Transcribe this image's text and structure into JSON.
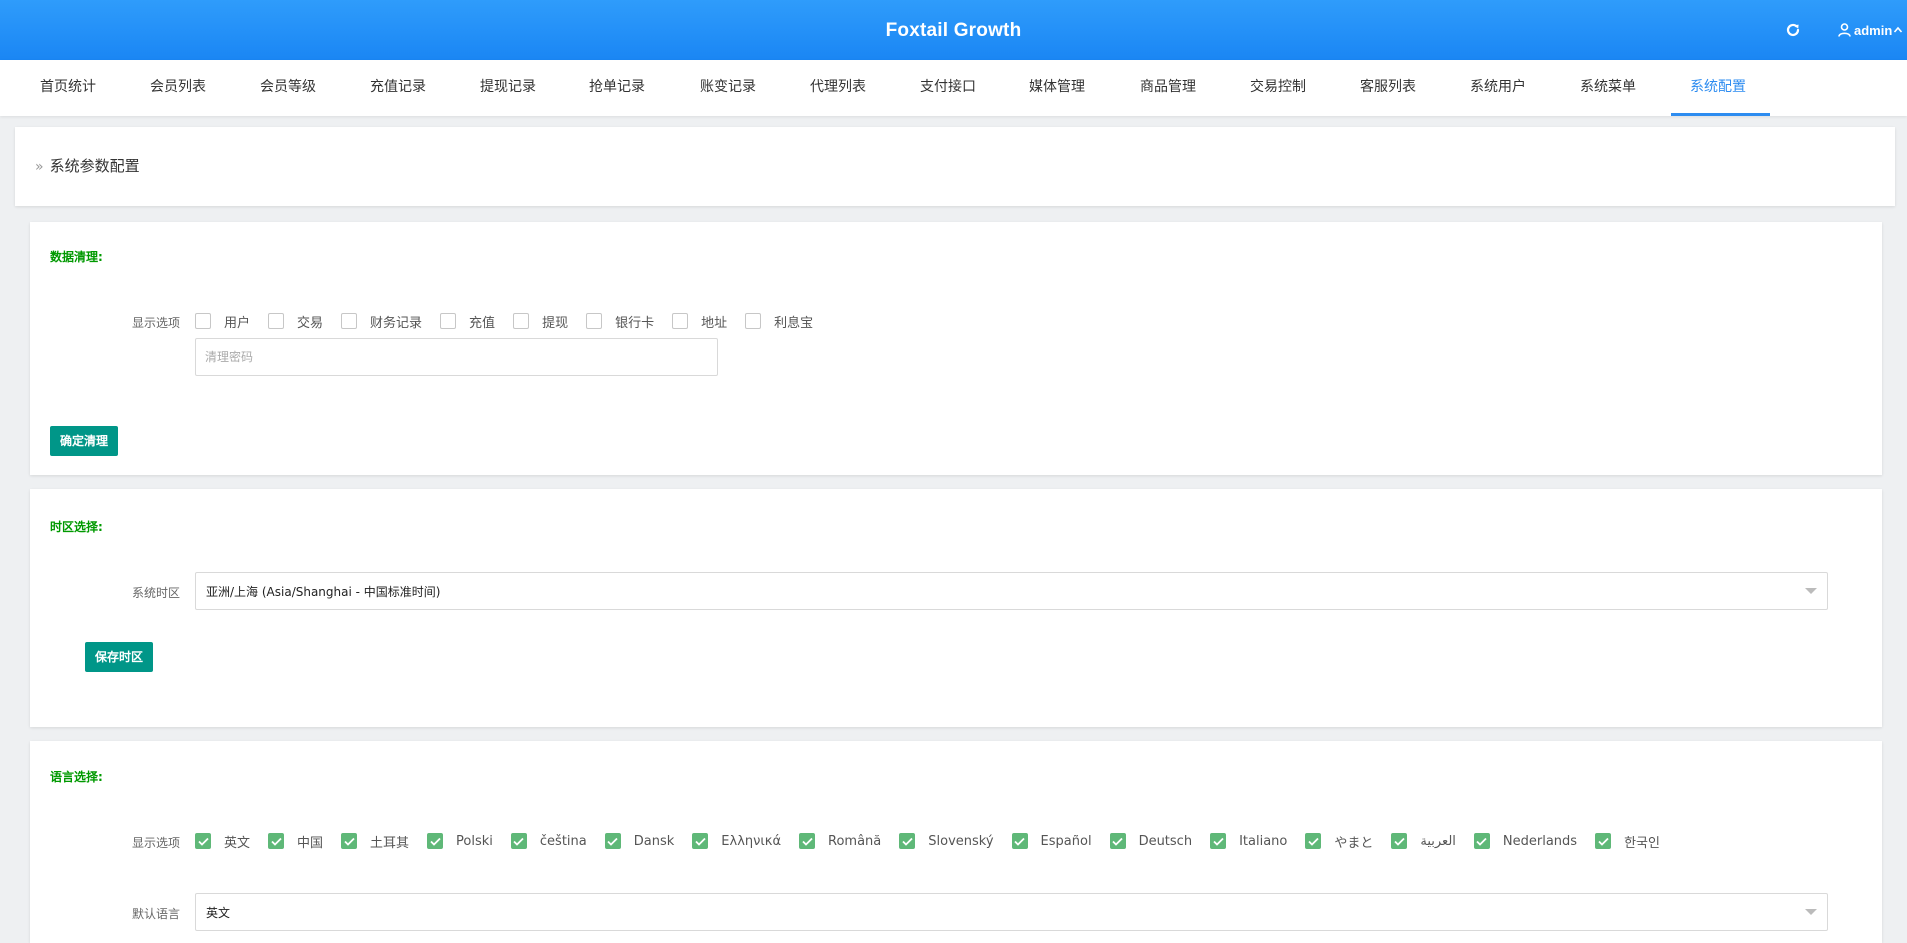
{
  "header": {
    "title": "Foxtail Growth",
    "refresh_icon": "refresh-icon",
    "user_icon": "user-icon",
    "user_name": "admin"
  },
  "nav": {
    "active_color": "#2d8cf0",
    "items": [
      {
        "label": "首页统计"
      },
      {
        "label": "会员列表"
      },
      {
        "label": "会员等级"
      },
      {
        "label": "充值记录"
      },
      {
        "label": "提现记录"
      },
      {
        "label": "抢单记录"
      },
      {
        "label": "账变记录"
      },
      {
        "label": "代理列表"
      },
      {
        "label": "支付接口"
      },
      {
        "label": "媒体管理"
      },
      {
        "label": "商品管理"
      },
      {
        "label": "交易控制"
      },
      {
        "label": "客服列表"
      },
      {
        "label": "系统用户"
      },
      {
        "label": "系统菜单"
      },
      {
        "label": "系统配置",
        "active": true
      }
    ]
  },
  "breadcrumb": {
    "chevron": "»",
    "title": "系统参数配置"
  },
  "data_cleanup": {
    "title": "数据清理:",
    "options_label": "显示选项",
    "options": [
      {
        "label": "用户",
        "checked": false
      },
      {
        "label": "交易",
        "checked": false
      },
      {
        "label": "财务记录",
        "checked": false
      },
      {
        "label": "充值",
        "checked": false
      },
      {
        "label": "提现",
        "checked": false
      },
      {
        "label": "银行卡",
        "checked": false
      },
      {
        "label": "地址",
        "checked": false
      },
      {
        "label": "利息宝",
        "checked": false
      }
    ],
    "password_value": "",
    "password_placeholder": "清理密码",
    "button_label": "确定清理"
  },
  "timezone": {
    "title": "时区选择:",
    "label": "系统时区",
    "selected": "亚洲/上海 (Asia/Shanghai - 中国标准时间)",
    "button_label": "保存时区"
  },
  "language": {
    "title": "语言选择:",
    "options_label": "显示选项",
    "options": [
      {
        "label": "英文",
        "checked": true
      },
      {
        "label": "中国",
        "checked": true
      },
      {
        "label": "土耳其",
        "checked": true
      },
      {
        "label": "Polski",
        "checked": true
      },
      {
        "label": "čeština",
        "checked": true
      },
      {
        "label": "Dansk",
        "checked": true
      },
      {
        "label": "Ελληνικά",
        "checked": true
      },
      {
        "label": "Română",
        "checked": true
      },
      {
        "label": "Slovenský",
        "checked": true
      },
      {
        "label": "Español",
        "checked": true
      },
      {
        "label": "Deutsch",
        "checked": true
      },
      {
        "label": "Italiano",
        "checked": true
      },
      {
        "label": "やまと",
        "checked": true
      },
      {
        "label": "العربية",
        "checked": true
      },
      {
        "label": "Nederlands",
        "checked": true
      },
      {
        "label": "한국인",
        "checked": true
      }
    ],
    "default_label": "默认语言",
    "default_selected": "英文"
  },
  "colors": {
    "header_blue": "#1a86f4",
    "section_title_green": "#009900",
    "button_teal": "#009688",
    "checkbox_green": "#5fb878"
  }
}
